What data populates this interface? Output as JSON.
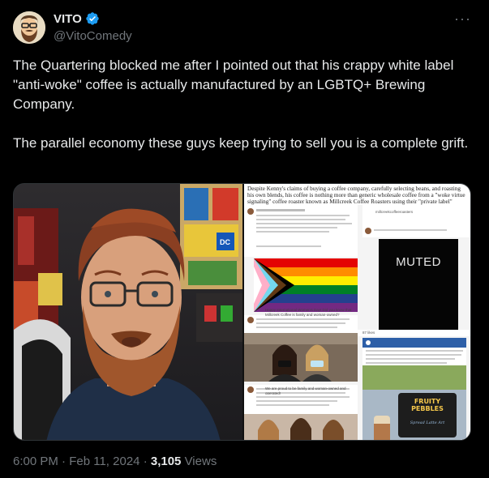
{
  "user": {
    "display_name": "VITO",
    "handle": "@VitoComedy",
    "avatar_icon": "cartoon-bearded-man-avatar",
    "verified_icon": "verified-badge-icon",
    "verified_color": "#1d9bf0"
  },
  "tweet": {
    "text": "The Quartering blocked me after I pointed out that his crappy white label \"anti-woke\" coffee is actually manufactured by an LGBTQ+ Brewing Company.\n\nThe parallel economy these guys keep trying to sell you is a complete grift.",
    "more_icon": "more-options-icon"
  },
  "media": {
    "article_excerpt": "Despite Kenny's claims of buying a coffee company, carefully selecting beans, and roasting his own blends, his coffee is nothing more than generic wholesale coffee from a \"woke virtue signaling\" coffee roaster known as Millcreek Coffee Roasters using their \"private label\" service which allows companies to sell Millcreek product repackaged as their own.",
    "muted_label": "MUTED",
    "poster_handle": "millcreekcoffeeroasters",
    "sign_text": "FRUITY PEBBLES",
    "sign_subtext": "Spread Latte Art",
    "post_caption": "Happy International Women's Day! Did you know that Millcreek Coffee is family and woman-owned?",
    "post_caption_2": "We are proud to be family and woman-owned and operated!",
    "likes": "87 likes"
  },
  "footer": {
    "time": "6:00 PM",
    "date": "Feb 11, 2024",
    "separator": "·",
    "views_count": "3,105",
    "views_label": "Views"
  },
  "colors": {
    "background": "#000000",
    "text_primary": "#e7e9ea",
    "text_secondary": "#71767b",
    "border": "#2f3336"
  }
}
